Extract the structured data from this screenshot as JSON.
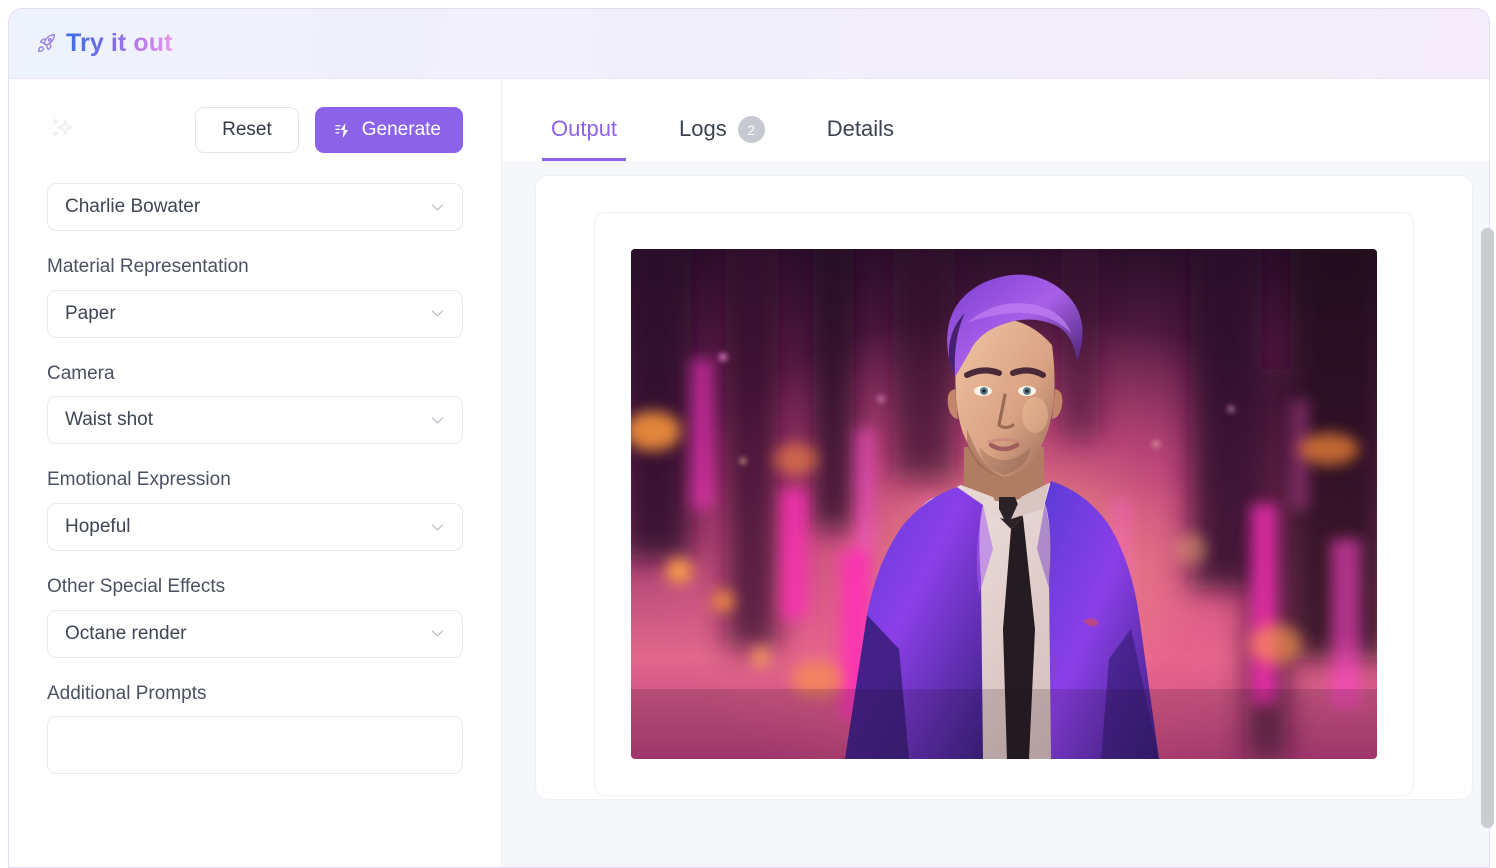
{
  "header": {
    "title": "Try it out",
    "icon": "rocket-icon"
  },
  "sidebar": {
    "decor_icon": "sparkles-icon",
    "reset_label": "Reset",
    "generate_label": "Generate",
    "generate_icon": "lightning-bolt-icon",
    "chevron_icon": "chevron-down-icon",
    "fields": [
      {
        "label": "",
        "value": "Charlie Bowater",
        "type": "select"
      },
      {
        "label": "Material Representation",
        "value": "Paper",
        "type": "select"
      },
      {
        "label": "Camera",
        "value": "Waist shot",
        "type": "select"
      },
      {
        "label": "Emotional Expression",
        "value": "Hopeful",
        "type": "select"
      },
      {
        "label": "Other Special Effects",
        "value": "Octane render",
        "type": "select"
      },
      {
        "label": "Additional Prompts",
        "value": "",
        "type": "textarea"
      }
    ]
  },
  "main": {
    "tabs": [
      {
        "label": "Output",
        "badge": "",
        "active": true
      },
      {
        "label": "Logs",
        "badge": "2",
        "active": false
      },
      {
        "label": "Details",
        "badge": "",
        "active": false
      }
    ],
    "output": {
      "image_alt": "Digital painting of a man with purple hair in a purple suit and dark tie, standing before a neon pink and purple cityscape"
    }
  },
  "colors": {
    "accent": "#8b62e8",
    "title_gradient_start": "#3b6fe3",
    "title_gradient_end": "#ea9ae8",
    "badge_bg": "#c6c9cf",
    "panel_bg": "#f5f7fb"
  }
}
